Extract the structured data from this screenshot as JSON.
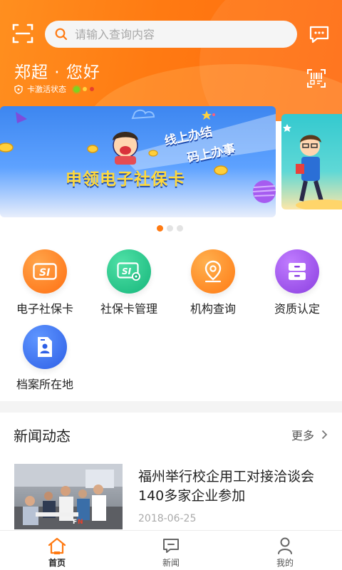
{
  "header": {
    "search_placeholder": "请输入查询内容",
    "greeting": "郑超 · 您好",
    "card_status_label": "卡激活状态",
    "brand_color": "#ff7a12"
  },
  "banner": {
    "title": "申领电子社保卡",
    "slogan_line1": "线上办结",
    "slogan_line2": "码上办事",
    "page_count": 3,
    "active_page": 1
  },
  "services": [
    {
      "label": "电子社保卡",
      "icon": "social-card-icon",
      "color": "#ff7a1e"
    },
    {
      "label": "社保卡管理",
      "icon": "card-manage-icon",
      "color": "#22c38b"
    },
    {
      "label": "机构查询",
      "icon": "location-pin-icon",
      "color": "#ff8a1c"
    },
    {
      "label": "资质认定",
      "icon": "archive-box-icon",
      "color": "#a150e8"
    },
    {
      "label": "档案所在地",
      "icon": "file-person-icon",
      "color": "#3c72ee"
    }
  ],
  "news": {
    "section_title": "新闻动态",
    "more_label": "更多",
    "items": [
      {
        "headline": "福州举行校企用工对接洽谈会　140多家企业参加",
        "date": "2018-06-25"
      }
    ]
  },
  "tabbar": {
    "tabs": [
      {
        "label": "首页",
        "active": true
      },
      {
        "label": "新闻",
        "active": false
      },
      {
        "label": "我的",
        "active": false
      }
    ]
  }
}
